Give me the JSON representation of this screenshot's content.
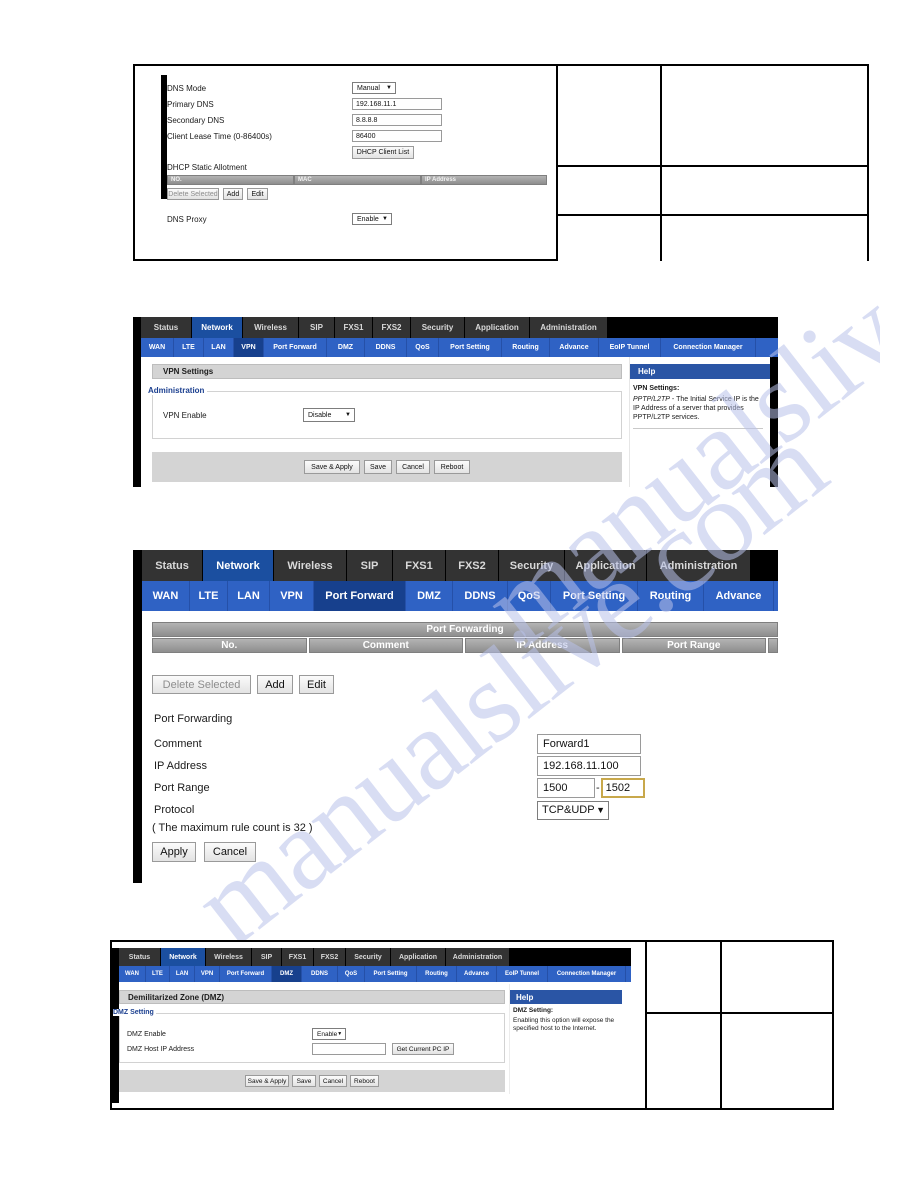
{
  "watermark": {
    "line1": "manualslive.com",
    "line2": "manualslive.com"
  },
  "panel1": {
    "name": "DNS / DHCP settings screenshot",
    "fields": [
      {
        "label": "DNS Mode",
        "type": "select",
        "value": "Manual"
      },
      {
        "label": "Primary DNS",
        "type": "text",
        "value": "192.168.11.1"
      },
      {
        "label": "Secondary DNS",
        "type": "text",
        "value": "8.8.8.8"
      },
      {
        "label": "Client Lease Time (0-86400s)",
        "type": "text",
        "value": "86400"
      }
    ],
    "dhcp_client_list_button": "DHCP Client List",
    "static_allotment_label": "DHCP Static Allotment",
    "table_headers": [
      "NO.",
      "MAC",
      "IP Address"
    ],
    "buttons": [
      "Delete Selected",
      "Add",
      "Edit"
    ],
    "dns_proxy_label": "DNS Proxy",
    "dns_proxy_value": "Enable"
  },
  "panel2": {
    "tabs_primary": [
      "Status",
      "Network",
      "Wireless",
      "SIP",
      "FXS1",
      "FXS2",
      "Security",
      "Application",
      "Administration"
    ],
    "tabs_primary_active": "Network",
    "tabs_secondary": [
      "WAN",
      "LTE",
      "LAN",
      "VPN",
      "Port Forward",
      "DMZ",
      "DDNS",
      "QoS",
      "Port Setting",
      "Routing",
      "Advance",
      "EoIP Tunnel",
      "Connection Manager"
    ],
    "tabs_secondary_active": "VPN",
    "title": "VPN Settings",
    "help_header": "Help",
    "help_title": "VPN Settings:",
    "help_italic": "PPTP/L2TP",
    "help_text": "- The Initial Service IP is the IP Address of a server that provides PPTP/L2TP services.",
    "section_label": "Administration",
    "field_label": "VPN Enable",
    "field_value": "Disable",
    "footer_buttons": [
      "Save & Apply",
      "Save",
      "Cancel",
      "Reboot"
    ]
  },
  "panel3": {
    "tabs_primary": [
      "Status",
      "Network",
      "Wireless",
      "SIP",
      "FXS1",
      "FXS2",
      "Security",
      "Application",
      "Administration"
    ],
    "tabs_primary_active": "Network",
    "tabs_secondary": [
      "WAN",
      "LTE",
      "LAN",
      "VPN",
      "Port Forward",
      "DMZ",
      "DDNS",
      "QoS",
      "Port Setting",
      "Routing",
      "Advance"
    ],
    "tabs_secondary_active": "Port Forward",
    "table_title": "Port Forwarding",
    "table_headers": [
      "No.",
      "Comment",
      "IP Address",
      "Port Range"
    ],
    "toolbar_buttons": [
      "Delete Selected",
      "Add",
      "Edit"
    ],
    "form_title": "Port Forwarding",
    "rows": [
      {
        "label": "Comment",
        "value": "Forward1"
      },
      {
        "label": "IP Address",
        "value": "192.168.11.100"
      }
    ],
    "port_range_label": "Port Range",
    "port_range_start": "1500",
    "port_range_sep": "-",
    "port_range_end": "1502",
    "protocol_label": "Protocol",
    "protocol_value": "TCP&UDP",
    "note": "( The maximum rule count is 32 )",
    "apply_button": "Apply",
    "cancel_button": "Cancel"
  },
  "panel4": {
    "tabs_primary": [
      "Status",
      "Network",
      "Wireless",
      "SIP",
      "FXS1",
      "FXS2",
      "Security",
      "Application",
      "Administration"
    ],
    "tabs_primary_active": "Network",
    "tabs_secondary": [
      "WAN",
      "LTE",
      "LAN",
      "VPN",
      "Port Forward",
      "DMZ",
      "DDNS",
      "QoS",
      "Port Setting",
      "Routing",
      "Advance",
      "EoIP Tunnel",
      "Connection Manager"
    ],
    "tabs_secondary_active": "DMZ",
    "title": "Demilitarized Zone (DMZ)",
    "help_header": "Help",
    "help_title": "DMZ Setting:",
    "help_text": "Enabling this option will expose the specified host to the Internet.",
    "section_label": "DMZ Setting",
    "enable_label": "DMZ Enable",
    "enable_value": "Enable",
    "host_label": "DMZ Host IP Address",
    "host_value": "",
    "get_ip_button": "Get Current PC IP",
    "footer_buttons": [
      "Save & Apply",
      "Save",
      "Cancel",
      "Reboot"
    ]
  }
}
